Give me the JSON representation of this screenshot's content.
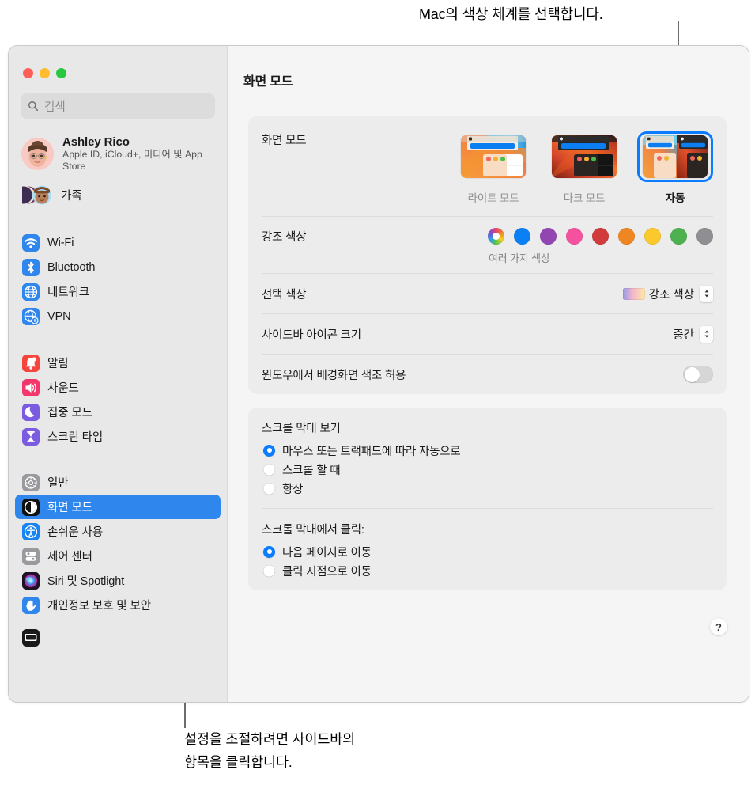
{
  "annotations": {
    "top": "Mac의 색상 체계를 선택합니다.",
    "bottom_line1": "설정을 조절하려면 사이드바의",
    "bottom_line2": "항목을 클릭합니다."
  },
  "window": {
    "title": "화면 모드",
    "traffic_lights": [
      "close",
      "minimize",
      "zoom"
    ]
  },
  "sidebar": {
    "search": {
      "placeholder": "검색",
      "icon": "search-icon"
    },
    "account": {
      "name": "Ashley Rico",
      "subtitle": "Apple ID, iCloud+, 미디어 및 App Store",
      "avatar": "memoji-avatar"
    },
    "family": {
      "label": "가족",
      "icon": "family-avatars-icon"
    },
    "groups": [
      {
        "items": [
          {
            "label": "Wi-Fi",
            "icon": "wifi-icon",
            "color": "#2f86ed",
            "selected": false
          },
          {
            "label": "Bluetooth",
            "icon": "bluetooth-icon",
            "color": "#2f86ed",
            "selected": false
          },
          {
            "label": "네트워크",
            "icon": "globe-icon",
            "color": "#2f86ed",
            "selected": false
          },
          {
            "label": "VPN",
            "icon": "vpn-globe-icon",
            "color": "#2f86ed",
            "selected": false
          }
        ]
      },
      {
        "items": [
          {
            "label": "알림",
            "icon": "bell-icon",
            "color": "#f5453c",
            "selected": false
          },
          {
            "label": "사운드",
            "icon": "speaker-icon",
            "color": "#f4366b",
            "selected": false
          },
          {
            "label": "집중 모드",
            "icon": "moon-icon",
            "color": "#7b5ce0",
            "selected": false
          },
          {
            "label": "스크린 타임",
            "icon": "hourglass-icon",
            "color": "#7b5ce0",
            "selected": false
          }
        ]
      },
      {
        "items": [
          {
            "label": "일반",
            "icon": "gear-icon",
            "color": "#9a9a9e",
            "selected": false
          },
          {
            "label": "화면 모드",
            "icon": "appearance-icon",
            "color": "#111111",
            "selected": true
          },
          {
            "label": "손쉬운 사용",
            "icon": "accessibility-icon",
            "color": "#1a84f2",
            "selected": false
          },
          {
            "label": "제어 센터",
            "icon": "control-center-icon",
            "color": "#9a9a9e",
            "selected": false
          },
          {
            "label": "Siri 및 Spotlight",
            "icon": "siri-icon",
            "color": "#2a1b3d",
            "selected": false
          },
          {
            "label": "개인정보 보호 및 보안",
            "icon": "privacy-hand-icon",
            "color": "#2f86ed",
            "selected": false
          }
        ]
      }
    ]
  },
  "main": {
    "appearance": {
      "label": "화면 모드",
      "options": [
        {
          "label": "라이트 모드",
          "value": "light",
          "selected": false
        },
        {
          "label": "다크 모드",
          "value": "dark",
          "selected": false
        },
        {
          "label": "자동",
          "value": "auto",
          "selected": true
        }
      ]
    },
    "accent": {
      "label": "강조 색상",
      "caption": "여러 가지 색상",
      "swatches": [
        {
          "name": "multicolor",
          "color": "multi",
          "selected": true
        },
        {
          "name": "blue",
          "color": "#0b80f4"
        },
        {
          "name": "purple",
          "color": "#9246b1"
        },
        {
          "name": "pink",
          "color": "#f4529f"
        },
        {
          "name": "red",
          "color": "#d13b3b"
        },
        {
          "name": "orange",
          "color": "#ef8621"
        },
        {
          "name": "yellow",
          "color": "#fac92c"
        },
        {
          "name": "green",
          "color": "#4cb14e"
        },
        {
          "name": "graphite",
          "color": "#8e8e93"
        }
      ]
    },
    "highlight": {
      "label": "선택 색상",
      "value": "강조 색상"
    },
    "sidebar_icon_size": {
      "label": "사이드바 아이콘 크기",
      "value": "중간"
    },
    "wallpaper_tinting": {
      "label": "윈도우에서 배경화면 색조 허용",
      "enabled": false
    },
    "scrollbar_show": {
      "title": "스크롤 막대 보기",
      "options": [
        {
          "label": "마우스 또는 트랙패드에 따라 자동으로",
          "selected": true
        },
        {
          "label": "스크롤 할 때",
          "selected": false
        },
        {
          "label": "항상",
          "selected": false
        }
      ]
    },
    "scrollbar_click": {
      "title": "스크롤 막대에서 클릭:",
      "options": [
        {
          "label": "다음 페이지로 이동",
          "selected": true
        },
        {
          "label": "클릭 지점으로 이동",
          "selected": false
        }
      ]
    },
    "help": {
      "label": "?"
    }
  }
}
